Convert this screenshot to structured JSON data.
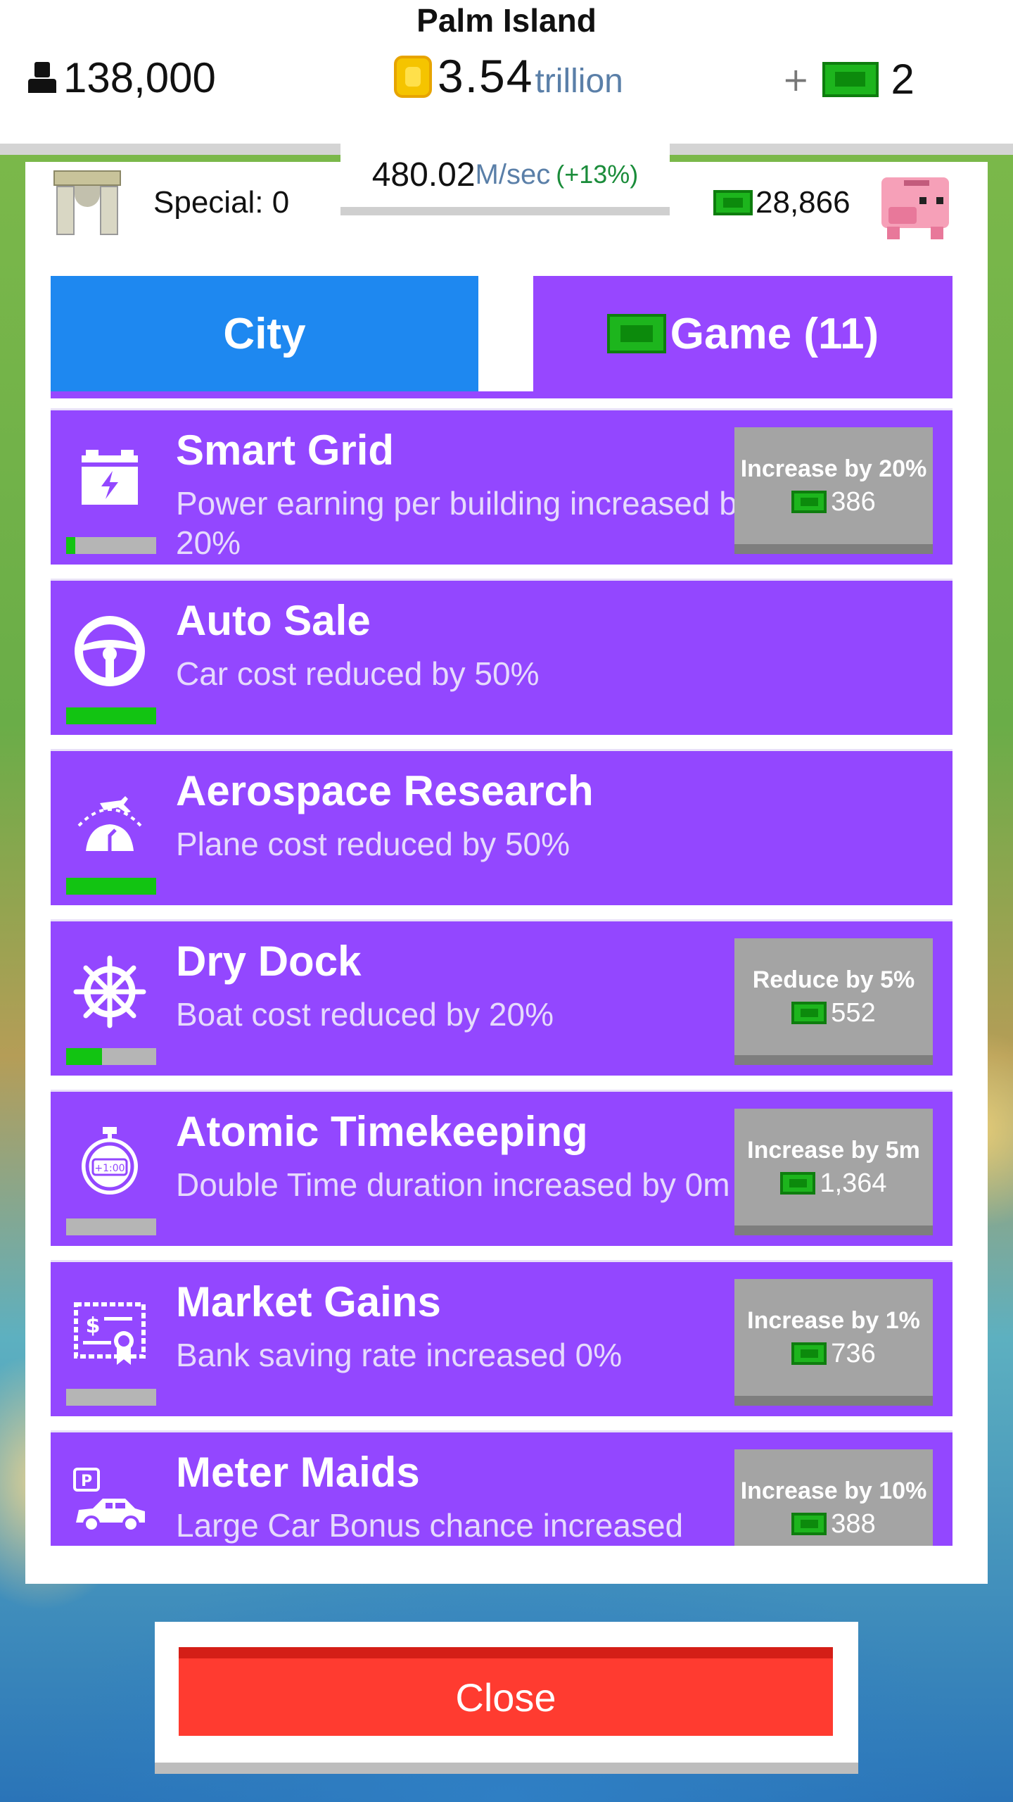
{
  "header": {
    "island_name": "Palm Island",
    "population": "138,000",
    "coins_value": "3.54",
    "coins_unit": "trillion",
    "plus": "+",
    "cash": "2"
  },
  "panel": {
    "special_label": "Special: 0",
    "income_value": "480.02",
    "income_unit": "M/sec",
    "income_pct": "(+13%)",
    "bank_cash": "28,866"
  },
  "tabs": {
    "city": "City",
    "game": "Game (11)"
  },
  "items": [
    {
      "title": "Smart Grid",
      "desc": "Power earning per building increased by 20%",
      "progress": 0.1,
      "buy_label": "Increase by 20%",
      "cost": "386",
      "icon": "battery-icon"
    },
    {
      "title": "Auto Sale",
      "desc": "Car cost reduced by 50%",
      "progress": 1.0,
      "icon": "steering-wheel-icon"
    },
    {
      "title": "Aerospace Research",
      "desc": "Plane cost reduced by 50%",
      "progress": 1.0,
      "icon": "plane-dome-icon"
    },
    {
      "title": "Dry Dock",
      "desc": "Boat cost reduced by 20%",
      "progress": 0.4,
      "buy_label": "Reduce by 5%",
      "cost": "552",
      "icon": "ship-wheel-icon"
    },
    {
      "title": "Atomic Timekeeping",
      "desc": "Double Time duration increased by 0m",
      "progress": 0.0,
      "buy_label": "Increase by 5m",
      "cost": "1,364",
      "icon": "stopwatch-icon"
    },
    {
      "title": "Market Gains",
      "desc": "Bank saving rate increased 0%",
      "progress": 0.0,
      "buy_label": "Increase by 1%",
      "cost": "736",
      "icon": "certificate-icon"
    },
    {
      "title": "Meter Maids",
      "desc": "Large Car Bonus chance increased",
      "buy_label": "Increase by 10%",
      "cost": "388",
      "icon": "parking-car-icon"
    }
  ],
  "close_label": "Close",
  "colors": {
    "purple": "#9347ff",
    "blue": "#1e88f0",
    "green_bill": "#1db51d",
    "close_red": "#ff3b30"
  }
}
